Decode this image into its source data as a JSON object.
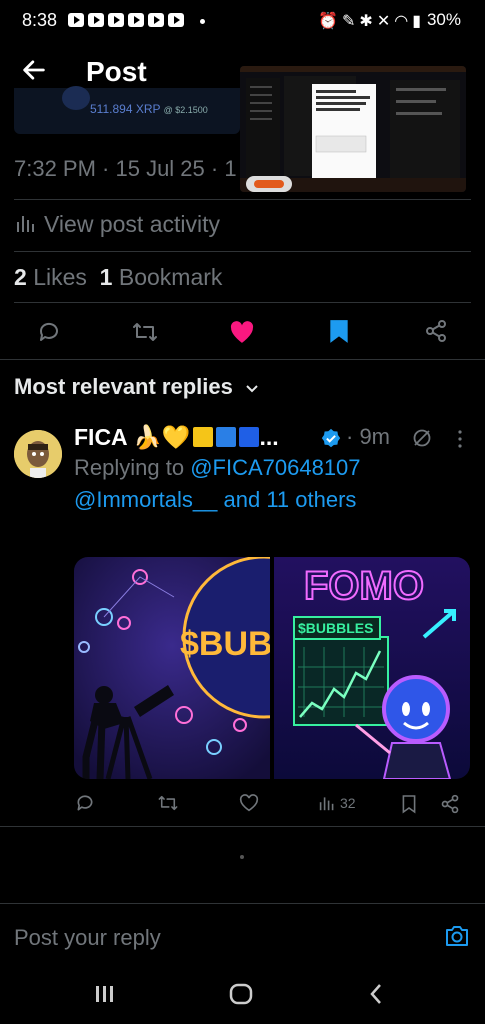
{
  "status": {
    "time": "8:38",
    "battery": "30%"
  },
  "header": {
    "title": "Post"
  },
  "quoted": {
    "amount": "511.894 XRP",
    "sub": "@ $2.1500"
  },
  "post": {
    "timestamp": "7:32 PM · 15 Jul 25 · 1",
    "view_activity": "View post activity",
    "likes_count": "2",
    "likes_label": "Likes",
    "bookmarks_count": "1",
    "bookmarks_label": "Bookmark"
  },
  "replies": {
    "section_label": "Most relevant replies",
    "reply": {
      "author": "FICA 🍌💛",
      "author_suffix": "...",
      "time": "· 9m",
      "replying_prefix": "Replying to",
      "mention1": "@FICA70648107",
      "mention2": "@Immortals__",
      "others": "and 11 others",
      "views": "32",
      "image_left_text": "$BUBE",
      "image_right_title": "FOMO",
      "image_right_sign": "$BUBBLES"
    }
  },
  "composer": {
    "placeholder": "Post your reply"
  },
  "colors": {
    "accent": "#1d9bf0",
    "like": "#f91880",
    "muted": "#71767b"
  }
}
